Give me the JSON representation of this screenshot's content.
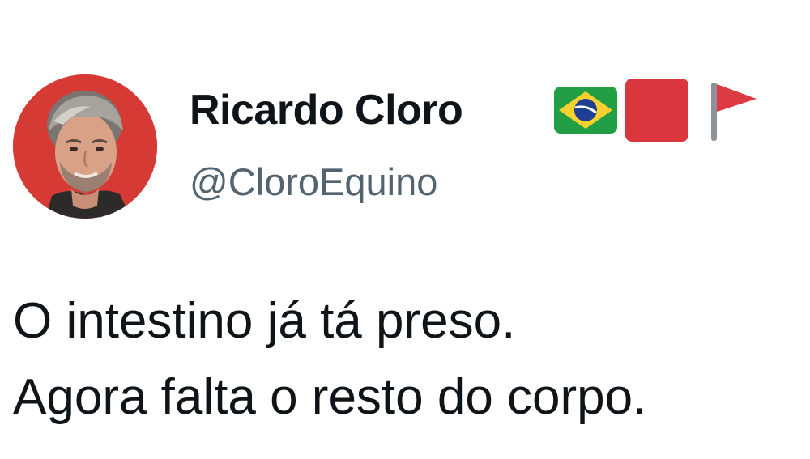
{
  "author": {
    "display_name": "Ricardo Cloro",
    "handle": "@CloroEquino",
    "name_emojis": [
      "brazil-flag-icon",
      "red-square-icon",
      "red-triangular-flag-icon"
    ]
  },
  "tweet": {
    "lines": [
      "O intestino já tá preso.",
      "Agora falta o resto do corpo."
    ]
  },
  "colors": {
    "text_primary": "#0f1419",
    "text_secondary": "#536471",
    "avatar_background": "#d63a35",
    "red_square": "#d9363e",
    "flag_red": "#dd3b44"
  }
}
